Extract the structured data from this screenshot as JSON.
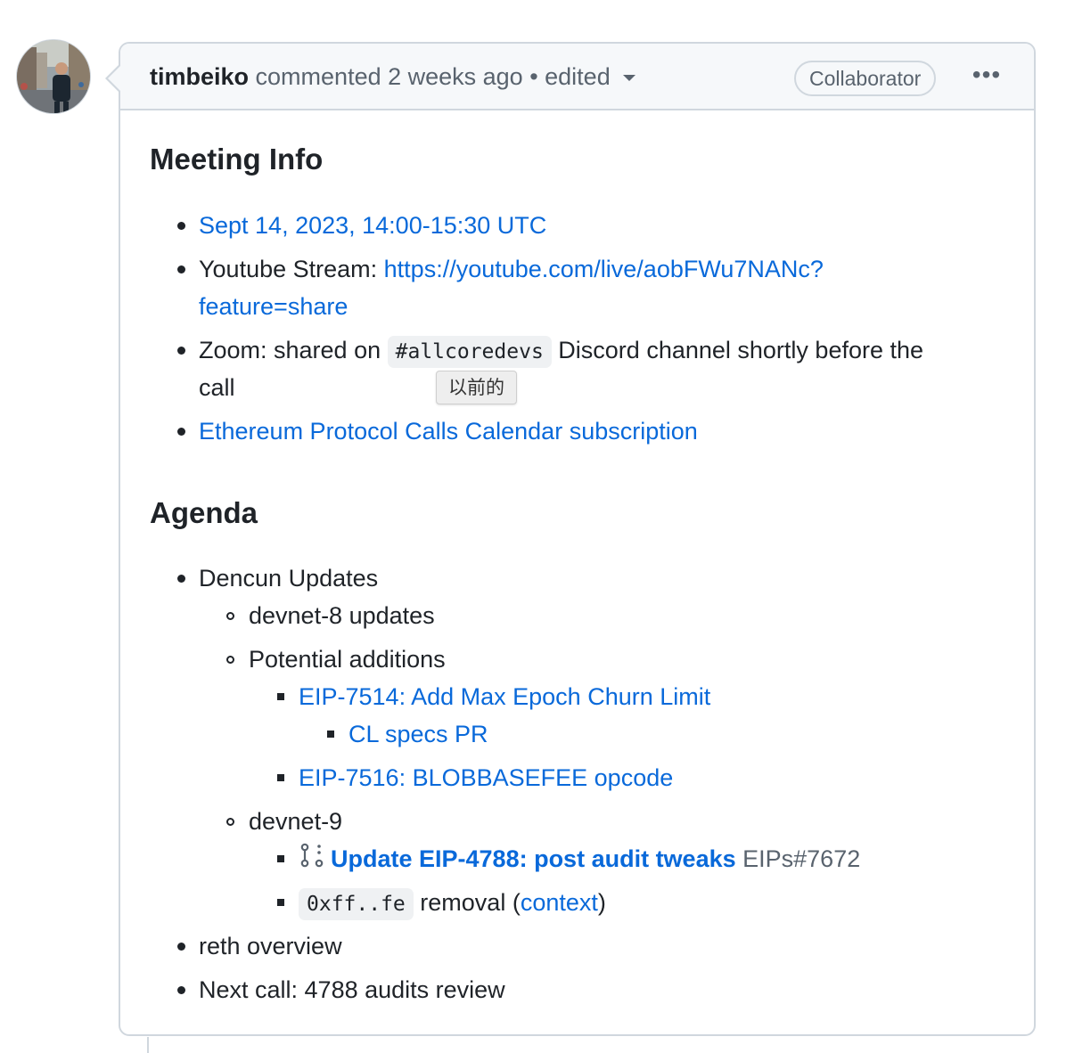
{
  "comment": {
    "author": "timbeiko",
    "meta": " commented 2 weeks ago • edited",
    "role_badge": "Collaborator",
    "more_label": "•••"
  },
  "meeting_info": {
    "heading": "Meeting Info",
    "date_link": "Sept 14, 2023, 14:00-15:30 UTC",
    "stream_prefix": "Youtube Stream: ",
    "stream_link_line1": "https://youtube.com/live/aobFWu7NANc?",
    "stream_link_line2": "feature=share",
    "zoom_prefix": "Zoom: shared on ",
    "zoom_channel": "#allcoredevs",
    "zoom_suffix_line1": " Discord channel shortly before the",
    "zoom_suffix_line2": "call",
    "tooltip": "以前的",
    "calendar_link": "Ethereum Protocol Calls Calendar subscription"
  },
  "agenda": {
    "heading": "Agenda",
    "dencun": "Dencun Updates",
    "devnet8": "devnet-8 updates",
    "potential": "Potential additions",
    "eip7514": "EIP-7514: Add Max Epoch Churn Limit",
    "cl_specs": "CL specs PR",
    "eip7516": "EIP-7516: BLOBBASEFEE opcode",
    "devnet9": "devnet-9",
    "pr_title": "Update EIP-4788: post audit tweaks",
    "pr_ref": " EIPs#7672",
    "ff_code": "0xff..fe",
    "removal_text": " removal (",
    "context_link": "context",
    "close_paren": ")",
    "reth": "reth overview",
    "next_call": "Next call: 4788 audits review"
  }
}
